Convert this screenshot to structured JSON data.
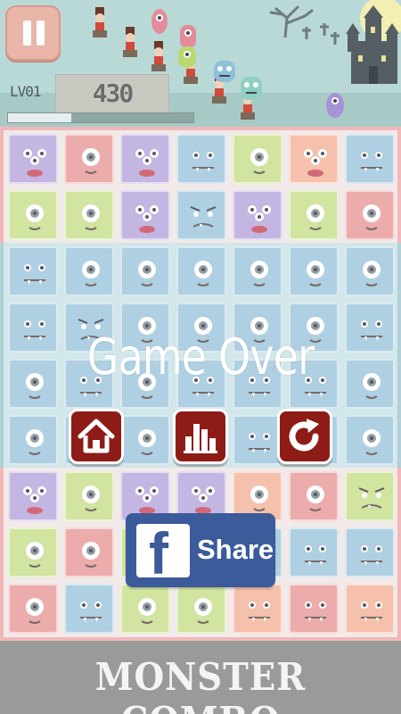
{
  "hud": {
    "level_label": "LV01",
    "score": "430",
    "progress_fraction": 0.34
  },
  "overlay": {
    "title": "Game Over",
    "home_icon": "home-icon",
    "leaderboard_icon": "bar-chart-icon",
    "restart_icon": "restart-icon"
  },
  "share": {
    "label": "Share",
    "logo_letter": "f"
  },
  "brand": {
    "title": "MONSTER COMBO"
  },
  "colors": {
    "purple": "#b7a6dc",
    "red": "#ea9a9a",
    "green": "#c7df8c",
    "blue": "#9ec6dc",
    "orange": "#f3b39a",
    "button_red": "#8e1c16",
    "facebook_blue": "#3b5b9b"
  },
  "board": {
    "columns": 7,
    "rows": [
      [
        [
          "purple",
          "three-eye"
        ],
        [
          "red",
          "cyclops"
        ],
        [
          "purple",
          "three-eye"
        ],
        [
          "blue",
          "fangs"
        ],
        [
          "green",
          "cyclops"
        ],
        [
          "orange",
          "three-eye"
        ],
        [
          "blue",
          "fangs"
        ]
      ],
      [
        [
          "green",
          "cyclops"
        ],
        [
          "green",
          "cyclops"
        ],
        [
          "purple",
          "three-eye"
        ],
        [
          "blue",
          "angry"
        ],
        [
          "purple",
          "three-eye"
        ],
        [
          "green",
          "cyclops"
        ],
        [
          "red",
          "cyclops"
        ]
      ],
      [
        [
          "blue",
          "fangs"
        ],
        [
          "blue",
          "cyclops"
        ],
        [
          "blue",
          "cyclops"
        ],
        [
          "blue",
          "cyclops"
        ],
        [
          "blue",
          "cyclops"
        ],
        [
          "blue",
          "cyclops"
        ],
        [
          "blue",
          "cyclops"
        ]
      ],
      [
        [
          "blue",
          "fangs"
        ],
        [
          "blue",
          "angry"
        ],
        [
          "blue",
          "cyclops"
        ],
        [
          "blue",
          "cyclops"
        ],
        [
          "blue",
          "cyclops"
        ],
        [
          "blue",
          "cyclops"
        ],
        [
          "blue",
          "fangs"
        ]
      ],
      [
        [
          "blue",
          "cyclops"
        ],
        [
          "blue",
          "fangs"
        ],
        [
          "blue",
          "cyclops"
        ],
        [
          "blue",
          "fangs"
        ],
        [
          "blue",
          "fangs"
        ],
        [
          "blue",
          "fangs"
        ],
        [
          "blue",
          "cyclops"
        ]
      ],
      [
        [
          "blue",
          "cyclops"
        ],
        [
          "blue",
          "cyclops"
        ],
        [
          "blue",
          "cyclops"
        ],
        [
          "blue",
          "cyclops"
        ],
        [
          "blue",
          "fangs"
        ],
        [
          "blue",
          "cyclops"
        ],
        [
          "blue",
          "cyclops"
        ]
      ],
      [
        [
          "purple",
          "three-eye"
        ],
        [
          "green",
          "cyclops"
        ],
        [
          "purple",
          "three-eye"
        ],
        [
          "purple",
          "three-eye"
        ],
        [
          "orange",
          "cyclops"
        ],
        [
          "red",
          "cyclops"
        ],
        [
          "green",
          "angry"
        ]
      ],
      [
        [
          "green",
          "cyclops"
        ],
        [
          "red",
          "cyclops"
        ],
        [
          "green",
          "cyclops"
        ],
        [
          "blue",
          "fangs"
        ],
        [
          "blue",
          "fangs"
        ],
        [
          "blue",
          "fangs"
        ],
        [
          "blue",
          "fangs"
        ]
      ],
      [
        [
          "red",
          "cyclops"
        ],
        [
          "blue",
          "fangs"
        ],
        [
          "green",
          "cyclops"
        ],
        [
          "green",
          "cyclops"
        ],
        [
          "orange",
          "fangs"
        ],
        [
          "red",
          "fangs"
        ],
        [
          "orange",
          "fangs"
        ]
      ]
    ]
  }
}
